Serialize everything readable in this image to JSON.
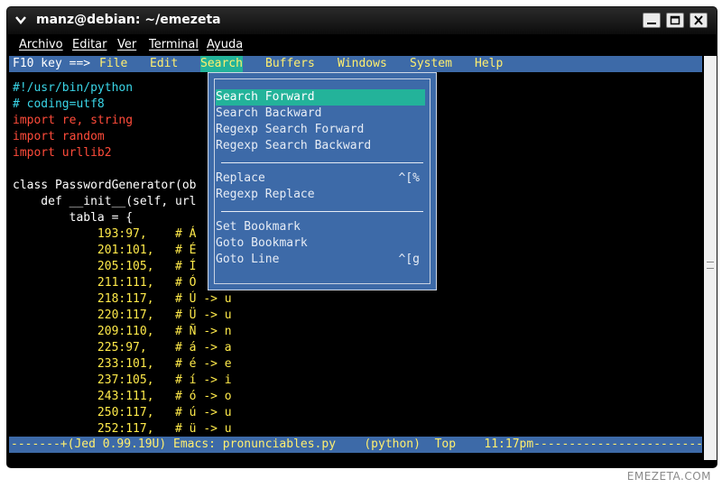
{
  "window": {
    "title": "manz@debian: ~/emezeta"
  },
  "menubar": [
    "Archivo",
    "Editar",
    "Ver",
    "Terminal",
    "Ayuda"
  ],
  "jed_menu": {
    "prefix": "F10 key ==>",
    "items": [
      "File",
      "Edit",
      "Search",
      "Buffers",
      "Windows",
      "System",
      "Help"
    ],
    "active": "Search"
  },
  "code_lines": [
    "#!/usr/bin/python",
    "# coding=utf8",
    "import re, string",
    "import random",
    "import urllib2",
    "",
    "class PasswordGenerator(ob",
    "    def __init__(self, url",
    "        tabla = {",
    "            193:97,    # Á",
    "            201:101,   # É",
    "            205:105,   # Í",
    "            211:111,   # Ó",
    "            218:117,   # Ú -> u",
    "            220:117,   # Ü -> u",
    "            209:110,   # Ñ -> n",
    "            225:97,    # á -> a",
    "            233:101,   # é -> e",
    "            237:105,   # í -> i",
    "            243:111,   # ó -> o",
    "            250:117,   # ú -> u",
    "            252:117,   # ü -> u"
  ],
  "search_menu": {
    "items": [
      {
        "label": "Search Forward",
        "selected": true
      },
      {
        "label": "Search Backward"
      },
      {
        "label": "Regexp Search Forward"
      },
      {
        "label": "Regexp Search Backward"
      },
      {
        "separator": true
      },
      {
        "label": "Replace",
        "shortcut": "^[%"
      },
      {
        "label": "Regexp Replace"
      },
      {
        "separator": true
      },
      {
        "label": "Set Bookmark"
      },
      {
        "label": "Goto Bookmark"
      },
      {
        "label": "Goto Line",
        "shortcut": "^[g"
      }
    ]
  },
  "modeline": "-------+(Jed 0.99.19U) Emacs: pronunciables.py    (python)  Top    11:17pm----------------------------",
  "watermark": "EMEZETA.COM",
  "colors": {
    "menu_bg": "#3d6aa8",
    "selection": "#23b39a",
    "hotkey": "#ffef6f",
    "keyword": "#ff4b3a"
  }
}
